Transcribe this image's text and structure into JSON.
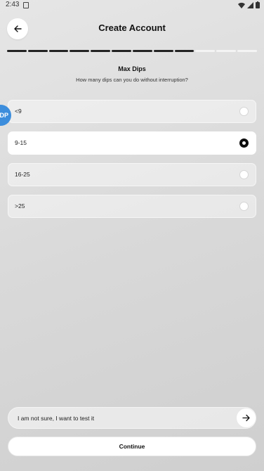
{
  "status": {
    "time": "2:43"
  },
  "header": {
    "title": "Create Account"
  },
  "progress": {
    "total_steps": 12,
    "completed_steps": 9
  },
  "question": {
    "title": "Max Dips",
    "subtitle": "How many dips can you do without interruption?"
  },
  "options": [
    {
      "label": "<9",
      "selected": false
    },
    {
      "label": "9-15",
      "selected": true
    },
    {
      "label": "16-25",
      "selected": false
    },
    {
      "label": ">25",
      "selected": false
    }
  ],
  "side_tab": {
    "label": "DP"
  },
  "unsure": {
    "label": "I am not sure, I want to test it"
  },
  "continue": {
    "label": "Continue"
  },
  "colors": {
    "accent": "#0d0d0d",
    "side_tab": "#3c8ddc",
    "background": "#d9d9d9"
  },
  "icons": {
    "back": "arrow-left-icon",
    "next": "arrow-right-icon",
    "wifi": "wifi-icon",
    "signal": "signal-icon",
    "battery": "battery-icon"
  }
}
